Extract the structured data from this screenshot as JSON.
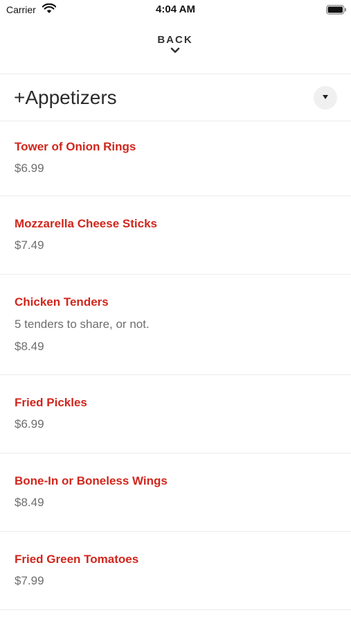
{
  "status_bar": {
    "carrier": "Carrier",
    "time": "4:04 AM"
  },
  "nav": {
    "back_label": "BACK"
  },
  "section": {
    "title": "+Appetizers"
  },
  "colors": {
    "item_name": "#d0261c",
    "muted_text": "#6e6e6e",
    "divider": "#ebebeb"
  },
  "items": [
    {
      "name": "Tower of Onion Rings",
      "description": "",
      "price": "$6.99"
    },
    {
      "name": "Mozzarella Cheese Sticks",
      "description": "",
      "price": "$7.49"
    },
    {
      "name": "Chicken Tenders",
      "description": "5 tenders to share, or not.",
      "price": "$8.49"
    },
    {
      "name": "Fried Pickles",
      "description": "",
      "price": "$6.99"
    },
    {
      "name": "Bone-In or Boneless Wings",
      "description": "",
      "price": "$8.49"
    },
    {
      "name": "Fried Green Tomatoes",
      "description": "",
      "price": "$7.99"
    }
  ]
}
